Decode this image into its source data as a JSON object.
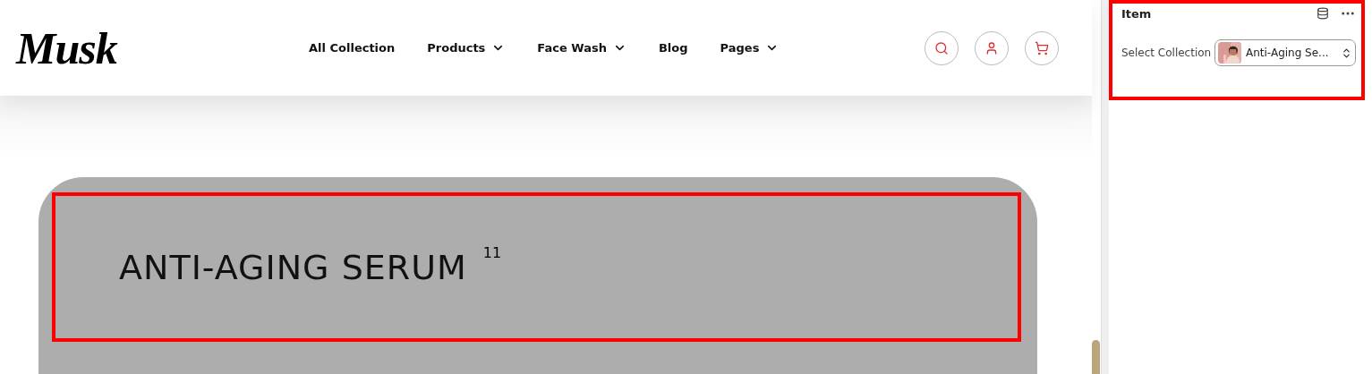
{
  "site": {
    "logo": "Musk",
    "nav": [
      {
        "label": "All Collection",
        "dropdown": false
      },
      {
        "label": "Products",
        "dropdown": true
      },
      {
        "label": "Face Wash",
        "dropdown": true
      },
      {
        "label": "Blog",
        "dropdown": false
      },
      {
        "label": "Pages",
        "dropdown": true
      }
    ],
    "header_actions": [
      {
        "kind": "search"
      },
      {
        "kind": "account"
      },
      {
        "kind": "cart"
      }
    ],
    "hero": {
      "title": "ANTI-AGING SERUM",
      "count": "11",
      "highlighted": true
    }
  },
  "panel": {
    "title": "Item",
    "highlighted": true,
    "field": {
      "label": "Select Collection",
      "value": "Anti-Aging Se..."
    }
  }
}
